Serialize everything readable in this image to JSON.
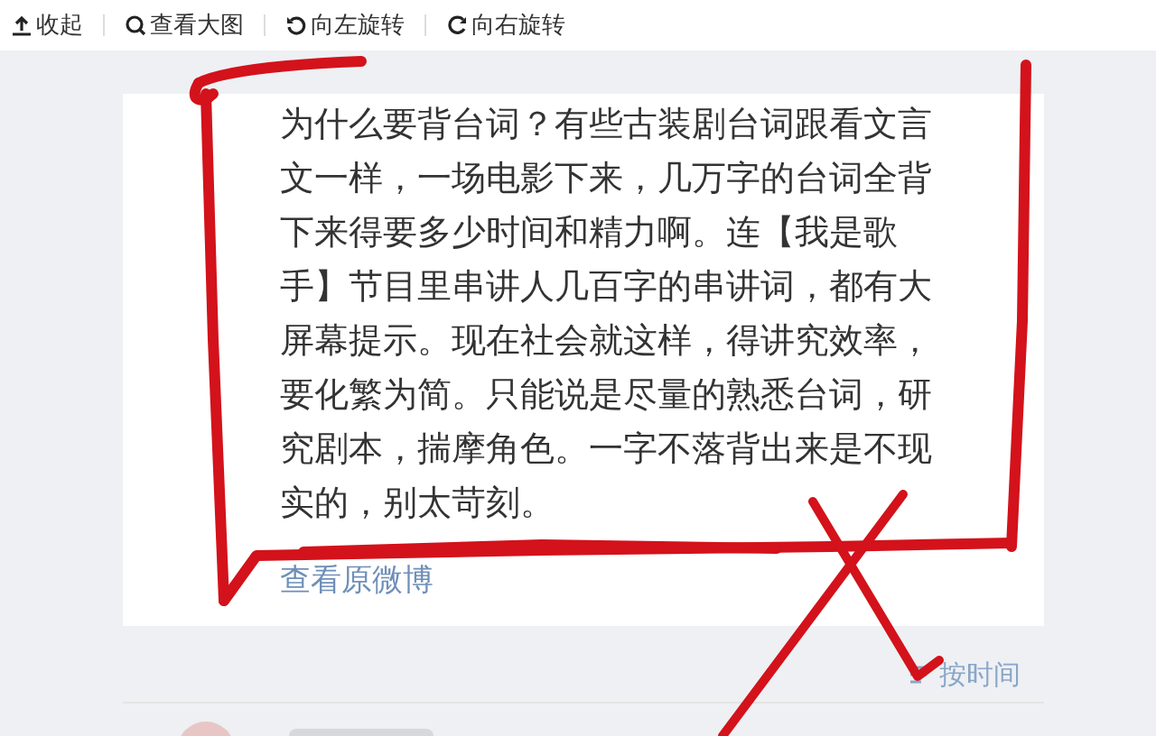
{
  "toolbar": [
    {
      "kind": "collapse",
      "label": "收起"
    },
    {
      "kind": "zoom",
      "label": "查看大图"
    },
    {
      "kind": "rotate_left",
      "label": "向左旋转"
    },
    {
      "kind": "rotate_right",
      "label": "向右旋转"
    }
  ],
  "post": {
    "text": "为什么要背台词？有些古装剧台词跟看文言文一样，一场电影下来，几万字的台词全背下来得要多少时间和精力啊。连【我是歌手】节目里串讲人几百字的串讲词，都有大屏幕提示。现在社会就这样，得讲究效率，要化繁为简。只能说是尽量的熟悉台词，研究剧本，揣摩角色。一字不落背出来是不现实的，别太苛刻。",
    "link": "查看原微博"
  },
  "sort": {
    "label": "按时间"
  }
}
